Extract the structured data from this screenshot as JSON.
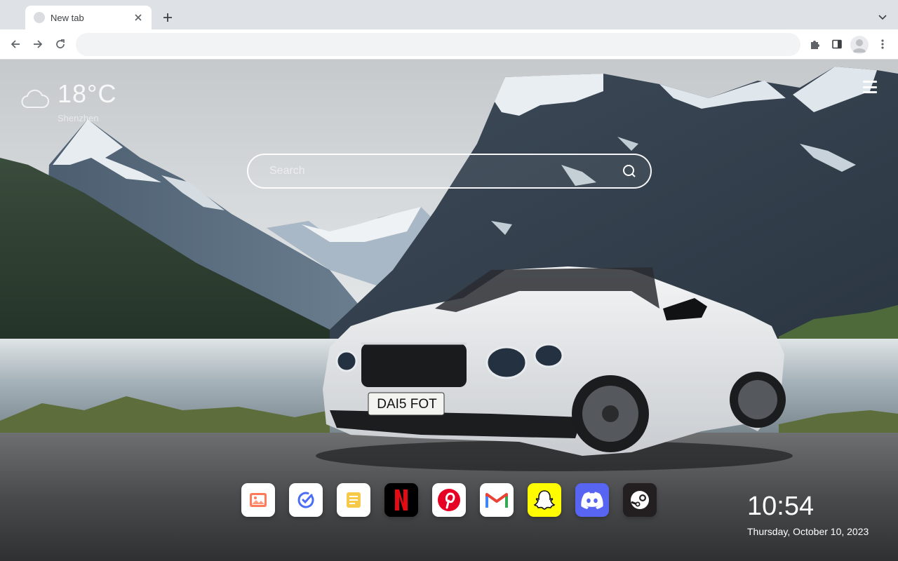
{
  "browser": {
    "tab_title": "New tab",
    "omnibox_value": ""
  },
  "weather": {
    "temperature": "18°C",
    "location": "Shenzhen",
    "icon": "cloud-icon"
  },
  "search": {
    "placeholder": "Search"
  },
  "apps": [
    {
      "name": "photos",
      "icon": "image-icon",
      "bg": "#ffffff"
    },
    {
      "name": "tasks",
      "icon": "check-circle-icon",
      "bg": "#ffffff"
    },
    {
      "name": "notes",
      "icon": "note-icon",
      "bg": "#ffffff"
    },
    {
      "name": "netflix",
      "icon": "netflix-icon",
      "bg": "#000000"
    },
    {
      "name": "pinterest",
      "icon": "pinterest-icon",
      "bg": "#ffffff"
    },
    {
      "name": "gmail",
      "icon": "gmail-icon",
      "bg": "#ffffff"
    },
    {
      "name": "snapchat",
      "icon": "snapchat-icon",
      "bg": "#fffc00"
    },
    {
      "name": "discord",
      "icon": "discord-icon",
      "bg": "#5865f2"
    },
    {
      "name": "steam",
      "icon": "steam-icon",
      "bg": "#231f20"
    }
  ],
  "clock": {
    "time": "10:54",
    "date": "Thursday, October 10, 2023"
  },
  "wallpaper": {
    "plate": "DAI5 FOT"
  }
}
